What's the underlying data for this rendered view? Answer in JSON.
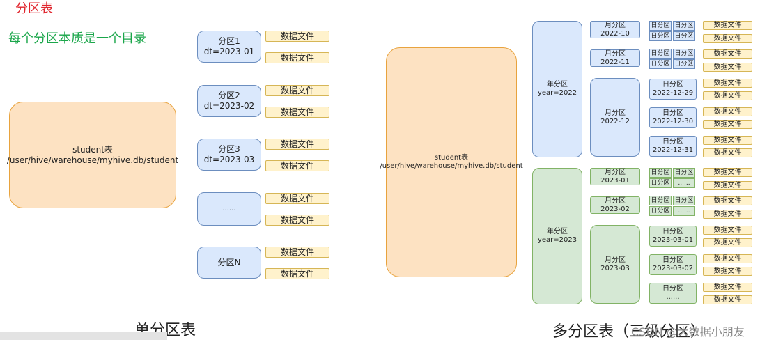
{
  "titles": {
    "partition_table": "分区表",
    "partition_note": "每个分区本质是一个目录",
    "single_caption": "单分区表",
    "multi_caption": "多分区表（三级分区）",
    "watermark": "CSDN @大数据小朋友"
  },
  "single": {
    "student_name": "student表",
    "student_path": "/user/hive/warehouse/myhive.db/student",
    "partitions": [
      {
        "name": "分区1",
        "spec": "dt=2023-01"
      },
      {
        "name": "分区2",
        "spec": "dt=2023-02"
      },
      {
        "name": "分区3",
        "spec": "dt=2023-03"
      },
      {
        "name": "......",
        "spec": ""
      },
      {
        "name": "分区N",
        "spec": ""
      }
    ],
    "file_label": "数据文件"
  },
  "multi": {
    "student_name": "student表",
    "student_path": "/user/hive/warehouse/myhive.db/student",
    "year_label": "年分区",
    "years": [
      "year=2022",
      "year=2023"
    ],
    "month_label": "月分区",
    "months": [
      "2022-10",
      "2022-11",
      "2022-12",
      "2023-01",
      "2023-02",
      "2023-03"
    ],
    "day_label": "日分区",
    "days": [
      "2022-12-29",
      "2022-12-30",
      "2022-12-31",
      "2023-03-01",
      "2023-03-02",
      "......"
    ],
    "ellipsis": "......",
    "file_label": "数据文件"
  },
  "colors": {
    "orange_fill": "#fde2c2",
    "blue_fill": "#dae8fc",
    "green_fill": "#d5e8d4",
    "file_fill": "#fff2cc",
    "title_red": "#e0252d",
    "title_green": "#1aa64a"
  }
}
